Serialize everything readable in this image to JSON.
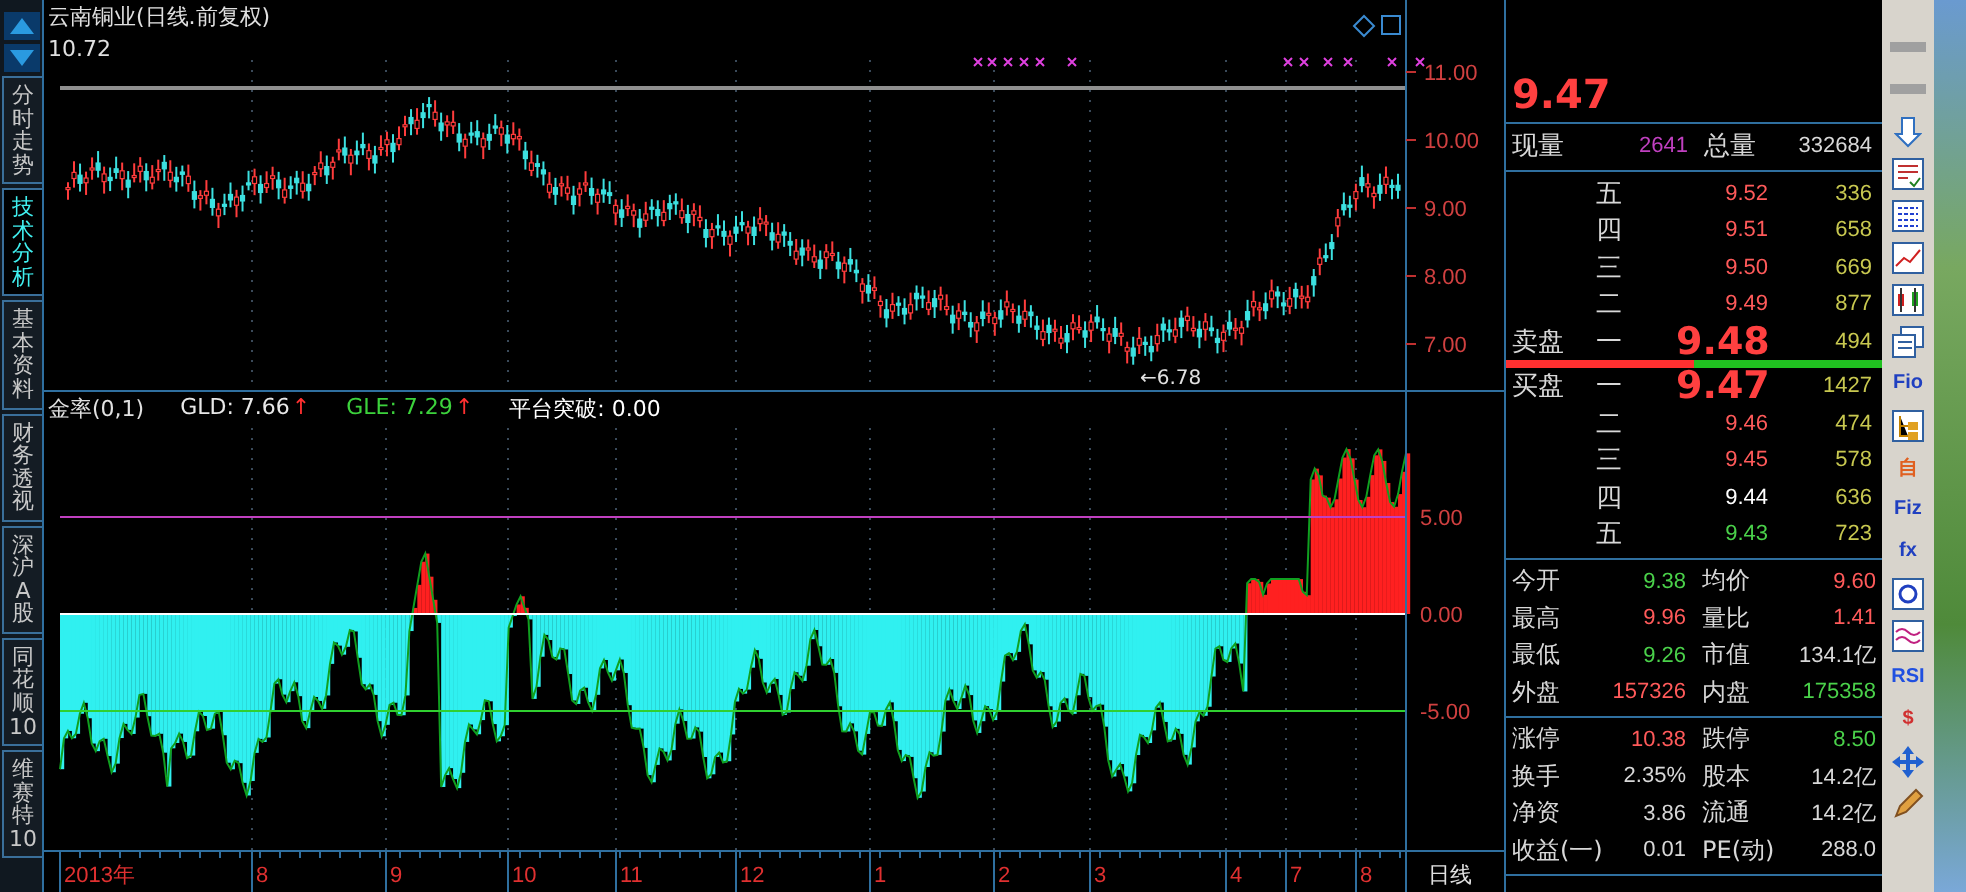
{
  "chart_title": "云南铜业(日线.前复权)",
  "price_label": "10.72",
  "tabs": [
    {
      "label": "分时走势",
      "selected": false
    },
    {
      "label": "技术分析",
      "selected": true
    },
    {
      "label": "基本资料",
      "selected": false
    },
    {
      "label": "财务透视",
      "selected": false
    },
    {
      "label": "深沪A股",
      "selected": false
    },
    {
      "label": "同花顺10",
      "selected": false
    },
    {
      "label": "维赛特10",
      "selected": false
    }
  ],
  "price_axis": [
    "11.00",
    "10.00",
    "9.00",
    "8.00",
    "7.00"
  ],
  "low_marker": "←6.78",
  "indicator": {
    "name": "金率(0,1)",
    "readings": [
      {
        "label": "GLD: 7.66",
        "arrow": "↑",
        "color": "#e8e8e8"
      },
      {
        "label": "GLE: 7.29",
        "arrow": "↑",
        "color": "#3cd23c"
      },
      {
        "label": "平台突破: 0.00",
        "color": "#ffffff"
      }
    ],
    "axis": [
      "5.00",
      "0.00",
      "-5.00"
    ]
  },
  "date_axis": [
    "2013年",
    "8",
    "9",
    "10",
    "11",
    "12",
    "1",
    "2",
    "3",
    "4",
    "7",
    "8"
  ],
  "period": "日线",
  "quote": {
    "last": "9.47",
    "volume": [
      {
        "label": "现量",
        "value": "2641"
      },
      {
        "label": "总量",
        "value": "332684"
      }
    ],
    "asks": [
      {
        "level": "五",
        "price": "9.52",
        "volume": "336",
        "color": "#ff5a5a"
      },
      {
        "level": "四",
        "price": "9.51",
        "volume": "658",
        "color": "#ff5a5a"
      },
      {
        "level": "三",
        "price": "9.50",
        "volume": "669",
        "color": "#ff5a5a"
      },
      {
        "level": "二",
        "price": "9.49",
        "volume": "877",
        "color": "#ff5a5a"
      },
      {
        "side": "卖盘",
        "level": "一",
        "price": "9.48",
        "volume": "494",
        "color": "#ff4040"
      }
    ],
    "bids": [
      {
        "side": "买盘",
        "level": "一",
        "price": "9.47",
        "volume": "1427",
        "color": "#ff4040"
      },
      {
        "level": "二",
        "price": "9.46",
        "volume": "474",
        "color": "#ff5a5a"
      },
      {
        "level": "三",
        "price": "9.45",
        "volume": "578",
        "color": "#ff5a5a"
      },
      {
        "level": "四",
        "price": "9.44",
        "volume": "636",
        "color": "#ffffff"
      },
      {
        "level": "五",
        "price": "9.43",
        "volume": "723",
        "color": "#4ad14a"
      }
    ],
    "stats": [
      [
        {
          "label": "今开",
          "value": "9.38",
          "color": "#4ad14a"
        },
        {
          "label": "均价",
          "value": "9.60",
          "color": "#ff5a5a"
        }
      ],
      [
        {
          "label": "最高",
          "value": "9.96",
          "color": "#ff5a5a"
        },
        {
          "label": "量比",
          "value": "1.41",
          "color": "#ff5a5a"
        }
      ],
      [
        {
          "label": "最低",
          "value": "9.26",
          "color": "#4ad14a"
        },
        {
          "label": "市值",
          "value": "134.1亿",
          "color": "#d8d8d8"
        }
      ],
      [
        {
          "label": "外盘",
          "value": "157326",
          "color": "#ff5a5a"
        },
        {
          "label": "内盘",
          "value": "175358",
          "color": "#4ad14a"
        }
      ]
    ],
    "limits": [
      [
        {
          "label": "涨停",
          "value": "10.38",
          "color": "#ff5a5a"
        },
        {
          "label": "跌停",
          "value": "8.50",
          "color": "#4ad14a"
        }
      ],
      [
        {
          "label": "换手",
          "value": "2.35%",
          "color": "#d8d8d8"
        },
        {
          "label": "股本",
          "value": "14.2亿",
          "color": "#d8d8d8"
        }
      ],
      [
        {
          "label": "净资",
          "value": "3.86",
          "color": "#d8d8d8"
        },
        {
          "label": "流通",
          "value": "14.2亿",
          "color": "#d8d8d8"
        }
      ],
      [
        {
          "label": "收益(一)",
          "value": "0.01",
          "color": "#d8d8d8"
        },
        {
          "label": "PE(动)",
          "value": "288.0",
          "color": "#d8d8d8"
        }
      ]
    ]
  },
  "toolbar": [
    {
      "kind": "bar"
    },
    {
      "kind": "bar"
    },
    {
      "kind": "down-arrow"
    },
    {
      "kind": "checklist"
    },
    {
      "kind": "grid"
    },
    {
      "kind": "line"
    },
    {
      "kind": "candles"
    },
    {
      "kind": "windows"
    },
    {
      "kind": "label",
      "label": "Fio",
      "color": "#2040c0"
    },
    {
      "kind": "tree"
    },
    {
      "kind": "label",
      "label": "自",
      "color": "#e06020"
    },
    {
      "kind": "label",
      "label": "Fiz",
      "color": "#2040c0"
    },
    {
      "kind": "label",
      "label": "fx",
      "color": "#2040c0"
    },
    {
      "kind": "circle"
    },
    {
      "kind": "wave"
    },
    {
      "kind": "label",
      "label": "RSI",
      "color": "#2050e0"
    },
    {
      "kind": "label",
      "label": "$",
      "color": "#d03030"
    },
    {
      "kind": "move"
    },
    {
      "kind": "pencil"
    }
  ]
}
